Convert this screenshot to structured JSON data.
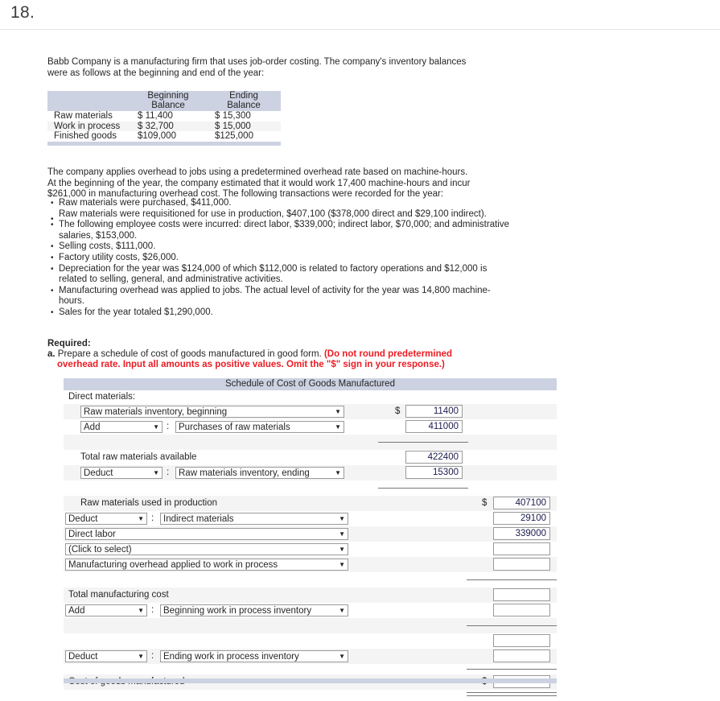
{
  "header": {
    "question_number": "18."
  },
  "problem": {
    "intro_line1": "Babb Company is a manufacturing firm that uses job-order costing. The company's inventory balances",
    "intro_line2": "were as follows at the beginning and end of the year:",
    "balance_table": {
      "col_header_blank": "",
      "col1_line1": "Beginning",
      "col1_line2": "Balance",
      "col2_line1": "Ending",
      "col2_line2": "Balance",
      "rows": [
        {
          "label": "Raw materials",
          "beginning": "$  11,400",
          "ending": "$  15,300"
        },
        {
          "label": "Work in process",
          "beginning": "$  32,700",
          "ending": "$  15,000"
        },
        {
          "label": "Finished goods",
          "beginning": "$109,000",
          "ending": "$125,000"
        }
      ]
    },
    "para2_line1": "The company applies overhead to jobs using a predetermined overhead rate based on machine-hours.",
    "para2_line2": "At the beginning of the year, the company estimated that it would work 17,400 machine-hours and incur",
    "para2_line3": "$261,000 in manufacturing overhead cost. The following transactions were recorded for the year:",
    "bullets": [
      "Raw materials were purchased, $411,000.",
      "Raw materials were requisitioned for use in production, $407,100 ($378,000 direct and $29,100 indirect).",
      "The following employee costs were incurred: direct labor, $339,000; indirect labor, $70,000; and administrative salaries, $153,000.",
      "Selling costs, $111,000.",
      "Factory utility costs, $26,000.",
      "Depreciation for the year was $124,000 of which $112,000 is related to factory operations and $12,000 is related to selling, general, and administrative activities.",
      "Manufacturing overhead was applied to jobs. The actual level of activity for the year was 14,800 machine-hours.",
      "Sales for the year totaled $1,290,000."
    ]
  },
  "required": {
    "heading": "Required:",
    "item_letter": "a.",
    "item_text": "Prepare a schedule of cost of goods manufactured in good form.",
    "note_line1": "(Do not round predetermined",
    "note_line2": "overhead rate. Input all amounts as positive values. Omit the \"$\" sign in your response.)"
  },
  "schedule": {
    "title": "Schedule of Cost of Goods Manufactured",
    "section_label": "Direct materials:",
    "dollar_sign": "$",
    "colon": ":",
    "dropdown_arrow": "▼",
    "rows": {
      "r1_account": "Raw materials inventory, beginning",
      "r1_value": "11400",
      "r2_op": "Add",
      "r2_account": "Purchases of raw materials",
      "r2_value": "411000",
      "r3_label": "Total raw materials available",
      "r3_value": "422400",
      "r4_op": "Deduct",
      "r4_account": "Raw materials inventory, ending",
      "r4_value": "15300",
      "r5_label": "Raw materials used in production",
      "r5_value": "407100",
      "r6_op": "Deduct",
      "r6_account": "Indirect materials",
      "r6_value": "29100",
      "r7_account": "Direct labor",
      "r7_value": "339000",
      "r8_account": "(Click to select)",
      "r8_value": "",
      "r9_account": "Manufacturing overhead applied to work in process",
      "r9_value": "",
      "r10_label": "Total manufacturing cost",
      "r10_value": "",
      "r11_op": "Add",
      "r11_account": "Beginning work in process inventory",
      "r11_value": "",
      "r12_value": "",
      "r13_op": "Deduct",
      "r13_account": "Ending work in process inventory",
      "r13_value": "",
      "r14_label": "Cost of goods manufactured",
      "r14_value": ""
    }
  },
  "colors": {
    "header_bar": "#ccd2e2",
    "row_alt": "#f4f4f4",
    "note_red": "#ed1c24",
    "input_text": "#1a1a4e"
  }
}
